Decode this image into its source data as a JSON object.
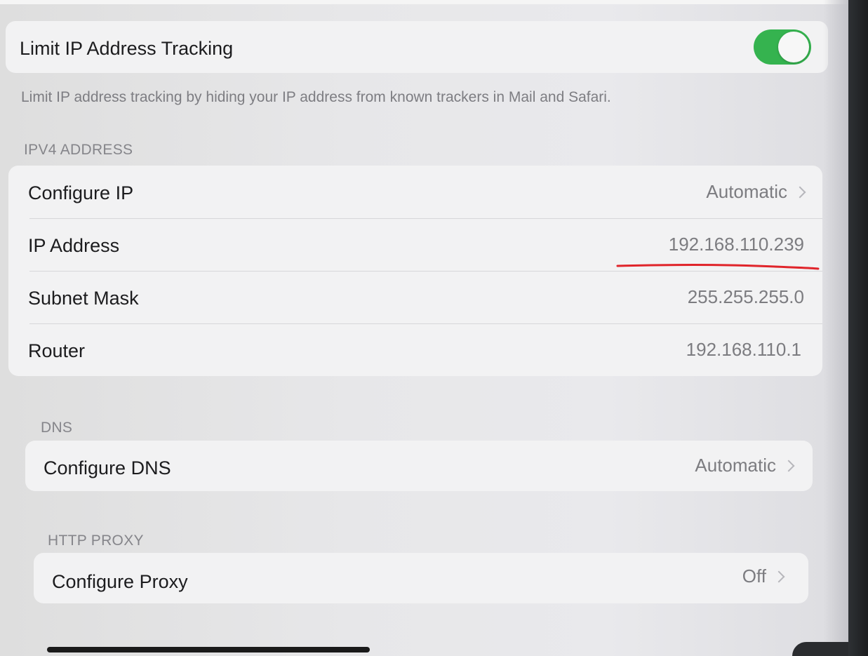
{
  "privacy": {
    "limit_ip_label": "Limit IP Address Tracking",
    "limit_ip_enabled": true,
    "limit_ip_footer": "Limit IP address tracking by hiding your IP address from known trackers in Mail and Safari."
  },
  "ipv4": {
    "header": "IPV4 ADDRESS",
    "rows": [
      {
        "label": "Configure IP",
        "value": "Automatic"
      },
      {
        "label": "IP Address",
        "value": "192.168.110.239"
      },
      {
        "label": "Subnet Mask",
        "value": "255.255.255.0"
      },
      {
        "label": "Router",
        "value": "192.168.110.1"
      }
    ]
  },
  "dns": {
    "header": "DNS",
    "configure_label": "Configure DNS",
    "configure_value": "Automatic"
  },
  "proxy": {
    "header": "HTTP PROXY",
    "configure_label": "Configure Proxy",
    "configure_value": "Off"
  },
  "colors": {
    "toggle_on": "#35b34f",
    "annotation": "#e0242a"
  }
}
